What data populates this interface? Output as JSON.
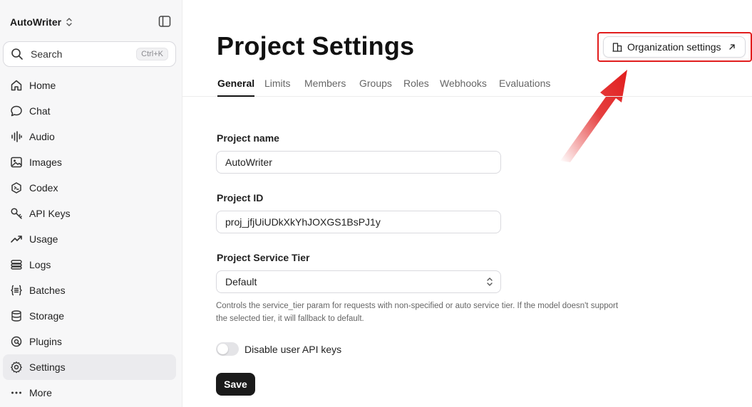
{
  "sidebar": {
    "workspace": "AutoWriter",
    "search": {
      "label": "Search",
      "shortcut": "Ctrl+K"
    },
    "items": [
      {
        "label": "Home",
        "icon": "home-icon"
      },
      {
        "label": "Chat",
        "icon": "chat-icon"
      },
      {
        "label": "Audio",
        "icon": "audio-icon"
      },
      {
        "label": "Images",
        "icon": "images-icon"
      },
      {
        "label": "Codex",
        "icon": "codex-icon"
      },
      {
        "label": "API Keys",
        "icon": "key-icon"
      },
      {
        "label": "Usage",
        "icon": "usage-icon"
      },
      {
        "label": "Logs",
        "icon": "logs-icon"
      },
      {
        "label": "Batches",
        "icon": "batches-icon"
      },
      {
        "label": "Storage",
        "icon": "storage-icon"
      },
      {
        "label": "Plugins",
        "icon": "plugins-icon"
      },
      {
        "label": "Settings",
        "icon": "gear-icon",
        "active": true
      },
      {
        "label": "More",
        "icon": "more-icon"
      }
    ]
  },
  "page": {
    "title": "Project Settings",
    "org_button": "Organization settings"
  },
  "tabs": [
    "General",
    "Limits",
    "Members",
    "Groups",
    "Roles",
    "Webhooks",
    "Evaluations"
  ],
  "form": {
    "project_name_label": "Project name",
    "project_name_value": "AutoWriter",
    "project_id_label": "Project ID",
    "project_id_value": "proj_jfjUiUDkXkYhJOXGS1BsPJ1y",
    "tier_label": "Project Service Tier",
    "tier_value": "Default",
    "tier_help": "Controls the service_tier param for requests with non-specified or auto service tier. If the model doesn't support the selected tier, it will fallback to default.",
    "toggle_label": "Disable user API keys",
    "toggle_on": false,
    "save_label": "Save"
  },
  "colors": {
    "accent": "#1a1a1a",
    "highlight": "#e11d1d",
    "sidebar_bg": "#f7f7f8"
  }
}
